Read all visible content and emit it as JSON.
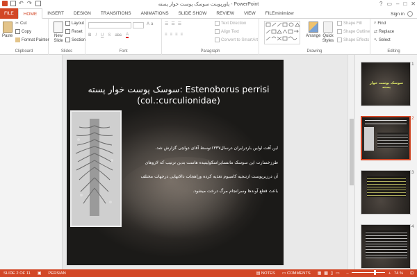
{
  "window": {
    "title": "پاورپوینت سوسک پوست خوار پسته - PowerPoint",
    "signin": "Sign in",
    "help": "?"
  },
  "tabs": [
    "FILE",
    "HOME",
    "INSERT",
    "DESIGN",
    "TRANSITIONS",
    "ANIMATIONS",
    "SLIDE SHOW",
    "REVIEW",
    "VIEW",
    "FILEminimizer"
  ],
  "ribbon": {
    "clipboard": {
      "paste": "Paste",
      "cut": "Cut",
      "copy": "Copy",
      "format_painter": "Format Painter",
      "label": "Clipboard"
    },
    "slides": {
      "new_slide": "New Slide",
      "layout": "Layout",
      "reset": "Reset",
      "section": "Section",
      "label": "Slides"
    },
    "font": {
      "label": "Font"
    },
    "paragraph": {
      "text_direction": "Text Direction",
      "align_text": "Align Text",
      "convert_smartart": "Convert to SmartArt",
      "label": "Paragraph"
    },
    "drawing": {
      "arrange": "Arrange",
      "quick_styles": "Quick Styles",
      "shape_fill": "Shape Fill",
      "shape_outline": "Shape Outline",
      "shape_effects": "Shape Effects",
      "label": "Drawing"
    },
    "editing": {
      "find": "Find",
      "replace": "Replace",
      "select": "Select",
      "label": "Editing"
    }
  },
  "slide": {
    "title_line1": "سوسک پوست خوار پسته: Estenoborus perrisi",
    "title_line2": "(col.:curculionidae)",
    "body_lines": [
      "این آفت اولین باردرایران درسال۱۳۳۷توسط آقای دواچی گزارش شد.",
      "طرزخسارت این سوسک ماننسایراسکولیتیده هاست بدین ترتیب که لاروهای",
      "آن درزیرپوست ازتنجیه کامبیوم تغذیه کرده وراهجات دالانهایی درجهات مختلف",
      "باعث قطع آوندها وسرانجام مرگ درخت میشود."
    ]
  },
  "thumbnails": [
    {
      "num": "1",
      "caption": "سوسک پوست خوار پسته"
    },
    {
      "num": "2",
      "caption": ""
    },
    {
      "num": "3",
      "caption": ""
    },
    {
      "num": "4",
      "caption": ""
    }
  ],
  "status": {
    "slide_counter": "SLIDE 2 OF 11",
    "language": "PERSIAN",
    "notes": "NOTES",
    "comments": "COMMENTS",
    "zoom": "74 %",
    "zoom_fraction": 0.74
  },
  "colors": {
    "accent": "#d24726"
  }
}
